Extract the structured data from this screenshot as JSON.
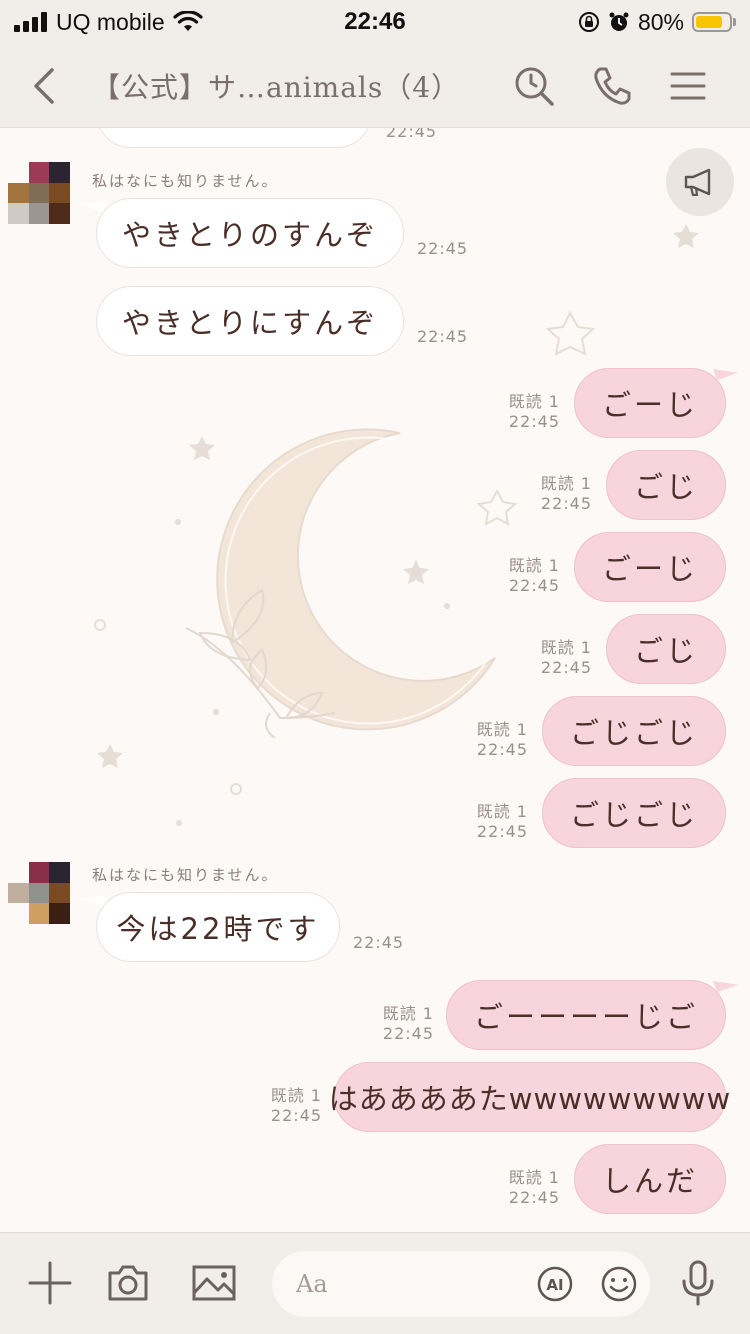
{
  "status_bar": {
    "carrier": "UQ mobile",
    "time": "22:46",
    "battery": "80%",
    "battery_level": 0.8
  },
  "header": {
    "title": "【公式】サ…animals（4）"
  },
  "chat": {
    "messages": [
      {
        "type": "in",
        "text": "",
        "time": "22:45"
      },
      {
        "type": "in",
        "sender": "私はなにも知りません。",
        "text": "やきとりのすんぞ",
        "time": "22:45"
      },
      {
        "type": "in",
        "text": "やきとりにすんぞ",
        "time": "22:45"
      },
      {
        "type": "out",
        "text": "ごーじ",
        "read": "既読 1",
        "time": "22:45"
      },
      {
        "type": "out",
        "text": "ごじ",
        "read": "既読 1",
        "time": "22:45"
      },
      {
        "type": "out",
        "text": "ごーじ",
        "read": "既読 1",
        "time": "22:45"
      },
      {
        "type": "out",
        "text": "ごじ",
        "read": "既読 1",
        "time": "22:45"
      },
      {
        "type": "out",
        "text": "ごじごじ",
        "read": "既読 1",
        "time": "22:45"
      },
      {
        "type": "out",
        "text": "ごじごじ",
        "read": "既読 1",
        "time": "22:45"
      },
      {
        "type": "in",
        "sender": "私はなにも知りません。",
        "text": "今は22時です",
        "time": "22:45"
      },
      {
        "type": "out",
        "text": "ごーーーーじご",
        "read": "既読 1",
        "time": "22:45"
      },
      {
        "type": "out",
        "text": "はああああたwwwwwwwww",
        "read": "既読 1",
        "time": "22:45"
      },
      {
        "type": "out",
        "text": "しんだ",
        "read": "既読 1",
        "time": "22:45"
      }
    ]
  },
  "input": {
    "placeholder": "Aa",
    "ai_label": "AI"
  },
  "colors": {
    "out_bubble": "#f8d4dc",
    "in_bubble": "#ffffff",
    "background": "#fcf9f6",
    "bar": "#f1ede9"
  }
}
